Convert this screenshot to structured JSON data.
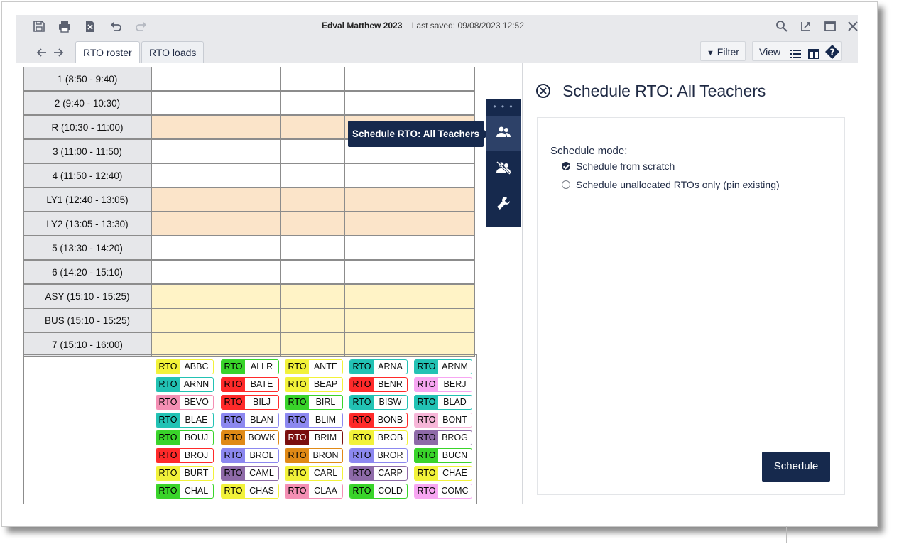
{
  "window": {
    "app_title": "Edval Matthew 2023",
    "last_saved": "Last saved: 09/08/2023 12:52"
  },
  "tabs": [
    {
      "label": "RTO roster",
      "active": true
    },
    {
      "label": "RTO loads",
      "active": false
    }
  ],
  "toolbar_right": {
    "filter_label": "Filter",
    "view_label": "View"
  },
  "periods": [
    {
      "label": "1  (8:50 - 9:40)",
      "type": "normal"
    },
    {
      "label": "2  (9:40 - 10:30)",
      "type": "normal"
    },
    {
      "label": "R  (10:30 - 11:00)",
      "type": "peach"
    },
    {
      "label": "3  (11:00 - 11:50)",
      "type": "normal"
    },
    {
      "label": "4  (11:50 - 12:40)",
      "type": "normal"
    },
    {
      "label": "LY1  (12:40 - 13:05)",
      "type": "peach"
    },
    {
      "label": "LY2  (13:05 - 13:30)",
      "type": "peach"
    },
    {
      "label": "5  (13:30 - 14:20)",
      "type": "normal"
    },
    {
      "label": "6  (14:20 - 15:10)",
      "type": "normal"
    },
    {
      "label": "ASY  (15:10 - 15:25)",
      "type": "yellow"
    },
    {
      "label": "BUS  (15:10 - 15:25)",
      "type": "yellow"
    },
    {
      "label": "7  (15:10 - 16:00)",
      "type": "yellow"
    }
  ],
  "chips": [
    [
      "ABBC",
      "ALLR",
      "ANTE",
      "ARNA",
      "ARNM"
    ],
    [
      "ARNN",
      "BATE",
      "BEAP",
      "BENR",
      "BERJ"
    ],
    [
      "BEVO",
      "BILJ",
      "BIRL",
      "BISW",
      "BLAD"
    ],
    [
      "BLAE",
      "BLAN",
      "BLIM",
      "BONB",
      "BONT"
    ],
    [
      "BOUJ",
      "BOWK",
      "BRIM",
      "BROB",
      "BROG"
    ],
    [
      "BROJ",
      "BROL",
      "BRON",
      "BROR",
      "BUCN"
    ],
    [
      "BURT",
      "CAML",
      "CARL",
      "CARP",
      "CHAE"
    ],
    [
      "CHAL",
      "CHAS",
      "CLAA",
      "COLD",
      "COMC"
    ]
  ],
  "chip_key": "RTO",
  "chip_colors": [
    [
      "#f2f23a",
      "#39d42a",
      "#f2f23a",
      "#22c2b4",
      "#22c2b4"
    ],
    [
      "#22c2b4",
      "#ff2a2a",
      "#f2f23a",
      "#ff2a2a",
      "#f7a6f2"
    ],
    [
      "#f48fb4",
      "#ff2a2a",
      "#39d42a",
      "#22c2b4",
      "#22c2b4"
    ],
    [
      "#22c2b4",
      "#8c88f0",
      "#8c88f0",
      "#ff2a2a",
      "#f7b6d8"
    ],
    [
      "#39d42a",
      "#e08a16",
      "#7a0e0e",
      "#f2f23a",
      "#8e6aa8"
    ],
    [
      "#ff2a2a",
      "#8c88f0",
      "#e08a16",
      "#8c88f0",
      "#39d42a"
    ],
    [
      "#f2f23a",
      "#8e6aa8",
      "#f2f23a",
      "#8e6aa8",
      "#f2f23a"
    ],
    [
      "#39d42a",
      "#f2f23a",
      "#f48fb4",
      "#39d42a",
      "#f7a6f2"
    ]
  ],
  "tooltip": "Schedule RTO: All Teachers",
  "panel": {
    "title": "Schedule RTO: All Teachers",
    "mode_label": "Schedule mode:",
    "option_scratch": "Schedule from scratch",
    "option_unallocated": "Schedule unallocated RTOs only (pin existing)",
    "schedule_button": "Schedule"
  },
  "colors": {
    "navy": "#16294d",
    "peach": "#fbe4c9",
    "yellow": "#fff3c6"
  }
}
